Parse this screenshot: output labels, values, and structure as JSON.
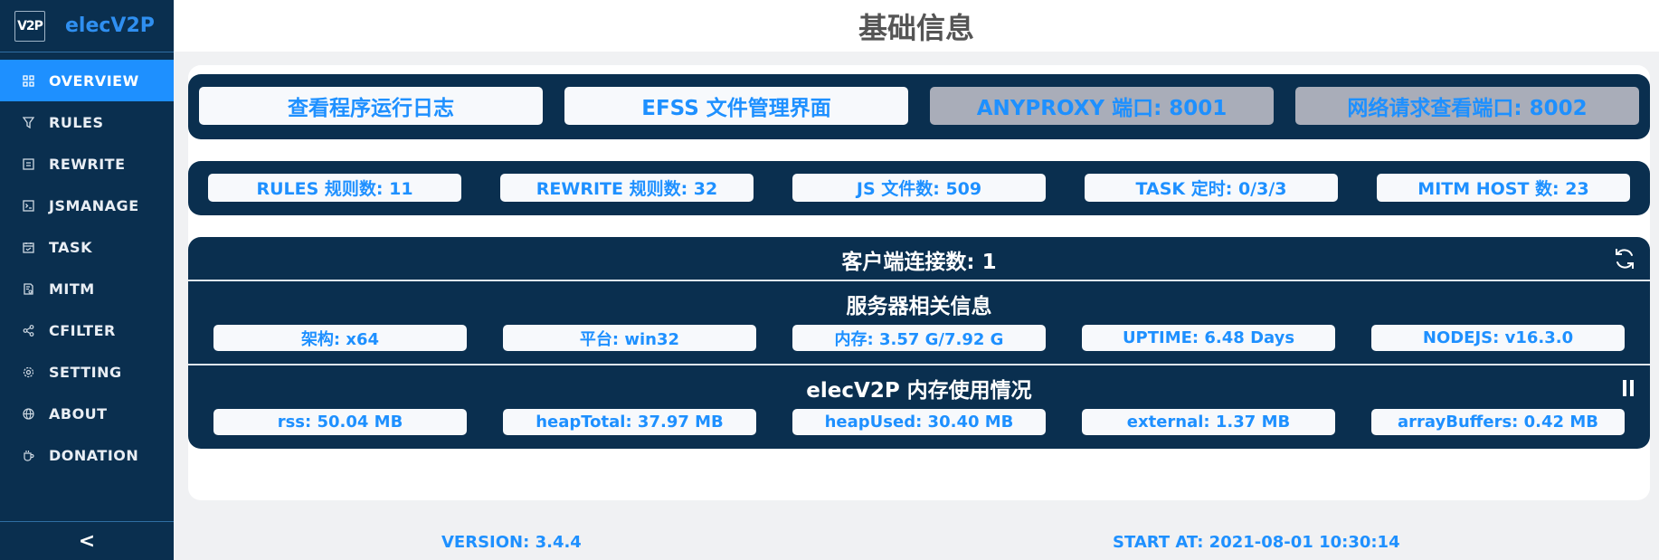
{
  "brand": {
    "logo": "V2P",
    "name": "elecV2P"
  },
  "sidebar": {
    "items": [
      {
        "label": "OVERVIEW",
        "icon": "grid-icon",
        "active": true
      },
      {
        "label": "RULES",
        "icon": "filter-icon"
      },
      {
        "label": "REWRITE",
        "icon": "rewrite-icon"
      },
      {
        "label": "JSMANAGE",
        "icon": "terminal-icon"
      },
      {
        "label": "TASK",
        "icon": "calendar-icon"
      },
      {
        "label": "MITM",
        "icon": "certificate-icon"
      },
      {
        "label": "CFILTER",
        "icon": "share-icon"
      },
      {
        "label": "SETTING",
        "icon": "gear-icon"
      },
      {
        "label": "ABOUT",
        "icon": "globe-icon"
      },
      {
        "label": "DONATION",
        "icon": "coffee-icon"
      }
    ],
    "collapse_label": "<"
  },
  "header": {
    "title": "基础信息"
  },
  "links": [
    {
      "label": "查看程序运行日志"
    },
    {
      "label": "EFSS 文件管理界面"
    },
    {
      "label": "ANYPROXY 端口: 8001"
    },
    {
      "label": "网络请求查看端口: 8002"
    }
  ],
  "stats": [
    {
      "label": "RULES 规则数: 11"
    },
    {
      "label": "REWRITE 规则数: 32"
    },
    {
      "label": "JS 文件数: 509"
    },
    {
      "label": "TASK 定时: 0/3/3"
    },
    {
      "label": "MITM HOST 数: 23"
    }
  ],
  "client": {
    "title": "客户端连接数: 1"
  },
  "server": {
    "title": "服务器相关信息",
    "items": [
      {
        "label": "架构: x64"
      },
      {
        "label": "平台: win32"
      },
      {
        "label": "内存: 3.57 G/7.92 G"
      },
      {
        "label": "UPTIME: 6.48 Days"
      },
      {
        "label": "NODEJS: v16.3.0"
      }
    ]
  },
  "memory": {
    "title": "elecV2P 内存使用情况",
    "items": [
      {
        "label": "rss: 50.04 MB"
      },
      {
        "label": "heapTotal: 37.97 MB"
      },
      {
        "label": "heapUsed: 30.40 MB"
      },
      {
        "label": "external: 1.37 MB"
      },
      {
        "label": "arrayBuffers: 0.42 MB"
      }
    ]
  },
  "footer": {
    "version": "VERSION: 3.4.4",
    "start": "START AT: 2021-08-01 10:30:14"
  },
  "colors": {
    "sidebar_bg": "#0a2f4f",
    "accent": "#1e90ff",
    "panel_bg": "#0a2f4f",
    "disabled_btn": "#a9adb9"
  }
}
